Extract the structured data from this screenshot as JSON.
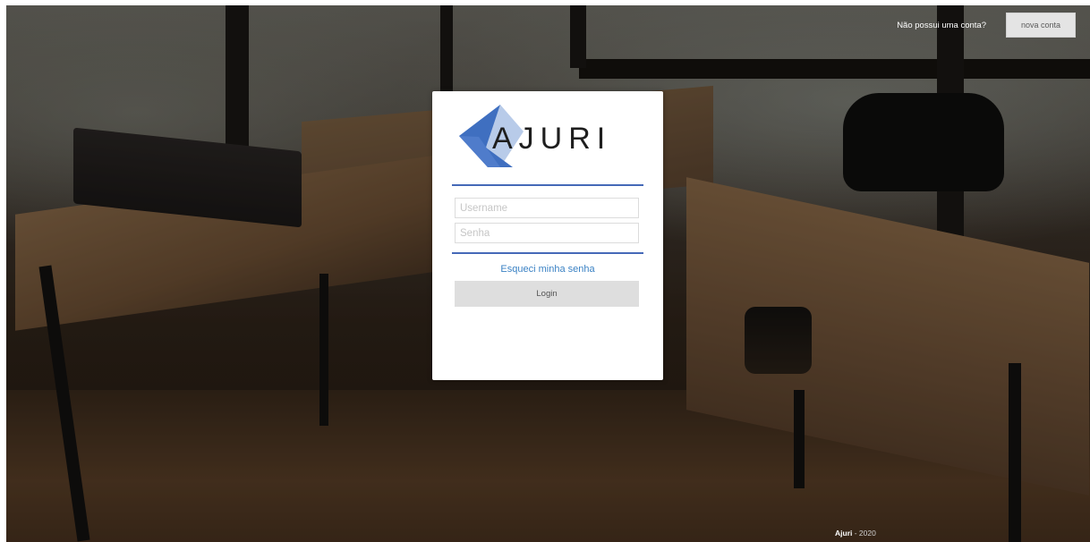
{
  "header": {
    "account_prompt": "Não possui uma conta?",
    "new_account_label": "nova conta"
  },
  "login_card": {
    "logo_text": "AJURI",
    "username_placeholder": "Username",
    "password_placeholder": "Senha",
    "forgot_password_label": "Esqueci minha senha",
    "login_button_label": "Login"
  },
  "footer": {
    "brand": "Ajuri",
    "year_text": " - 2020"
  },
  "colors": {
    "accent_blue": "#4569b8",
    "logo_dark_blue": "#3f6fc0",
    "logo_light_blue": "#b8cbe9",
    "link_blue": "#3b82c4",
    "button_gray": "#dedede"
  }
}
